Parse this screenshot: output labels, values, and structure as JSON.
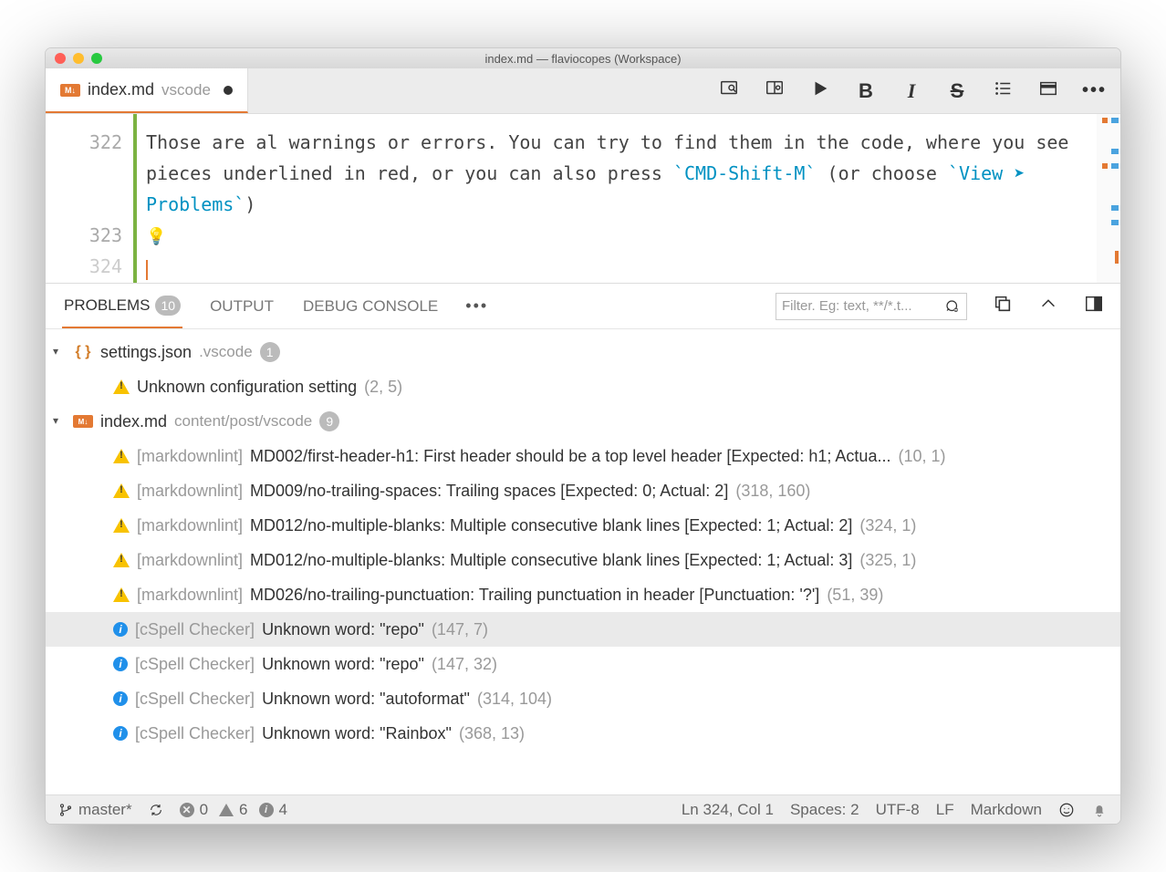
{
  "window": {
    "title": "index.md — flaviocopes (Workspace)"
  },
  "tab": {
    "filename": "index.md",
    "path": "vscode"
  },
  "editor_toolbar": {
    "preview": "preview",
    "split": "split-preview",
    "run": "run",
    "bold": "B",
    "italic": "I",
    "strike": "S",
    "list": "list",
    "table": "table",
    "more": "•••"
  },
  "editor": {
    "lines": [
      {
        "num": "322",
        "html": "Those are al warnings or errors. You can try to find them in the code, where you see pieces underlined in red, or you can also press <span class=\"tok-code\">`CMD-Shift-M`</span> (or choose <span class=\"tok-code\">`View ➤ Problems`</span>)"
      },
      {
        "num": "323",
        "html": "<span class=\"bulb\">💡</span>"
      },
      {
        "num": "324",
        "html": ""
      }
    ]
  },
  "panel": {
    "tabs": {
      "problems": "PROBLEMS",
      "problems_count": "10",
      "output": "OUTPUT",
      "debug": "DEBUG CONSOLE"
    },
    "filter_placeholder": "Filter. Eg: text, **/*.t..."
  },
  "problems": {
    "files": [
      {
        "name": "settings.json",
        "path": ".vscode",
        "icon": "json",
        "count": "1",
        "issues": [
          {
            "sev": "warn",
            "src": "",
            "msg": "Unknown configuration setting",
            "loc": "(2, 5)"
          }
        ]
      },
      {
        "name": "index.md",
        "path": "content/post/vscode",
        "icon": "md",
        "count": "9",
        "issues": [
          {
            "sev": "warn",
            "src": "[markdownlint]",
            "msg": "MD002/first-header-h1: First header should be a top level header [Expected: h1; Actua...",
            "loc": "(10, 1)"
          },
          {
            "sev": "warn",
            "src": "[markdownlint]",
            "msg": "MD009/no-trailing-spaces: Trailing spaces [Expected: 0; Actual: 2]",
            "loc": "(318, 160)"
          },
          {
            "sev": "warn",
            "src": "[markdownlint]",
            "msg": "MD012/no-multiple-blanks: Multiple consecutive blank lines [Expected: 1; Actual: 2]",
            "loc": "(324, 1)"
          },
          {
            "sev": "warn",
            "src": "[markdownlint]",
            "msg": "MD012/no-multiple-blanks: Multiple consecutive blank lines [Expected: 1; Actual: 3]",
            "loc": "(325, 1)"
          },
          {
            "sev": "warn",
            "src": "[markdownlint]",
            "msg": "MD026/no-trailing-punctuation: Trailing punctuation in header [Punctuation: '?']",
            "loc": "(51, 39)"
          },
          {
            "sev": "info",
            "src": "[cSpell Checker]",
            "msg": "Unknown word: \"repo\"",
            "loc": "(147, 7)",
            "selected": true
          },
          {
            "sev": "info",
            "src": "[cSpell Checker]",
            "msg": "Unknown word: \"repo\"",
            "loc": "(147, 32)"
          },
          {
            "sev": "info",
            "src": "[cSpell Checker]",
            "msg": "Unknown word: \"autoformat\"",
            "loc": "(314, 104)"
          },
          {
            "sev": "info",
            "src": "[cSpell Checker]",
            "msg": "Unknown word: \"Rainbox\"",
            "loc": "(368, 13)"
          }
        ]
      }
    ]
  },
  "status": {
    "branch": "master*",
    "errors": "0",
    "warnings": "6",
    "infos": "4",
    "cursor": "Ln 324, Col 1",
    "spaces": "Spaces: 2",
    "encoding": "UTF-8",
    "eol": "LF",
    "language": "Markdown"
  }
}
